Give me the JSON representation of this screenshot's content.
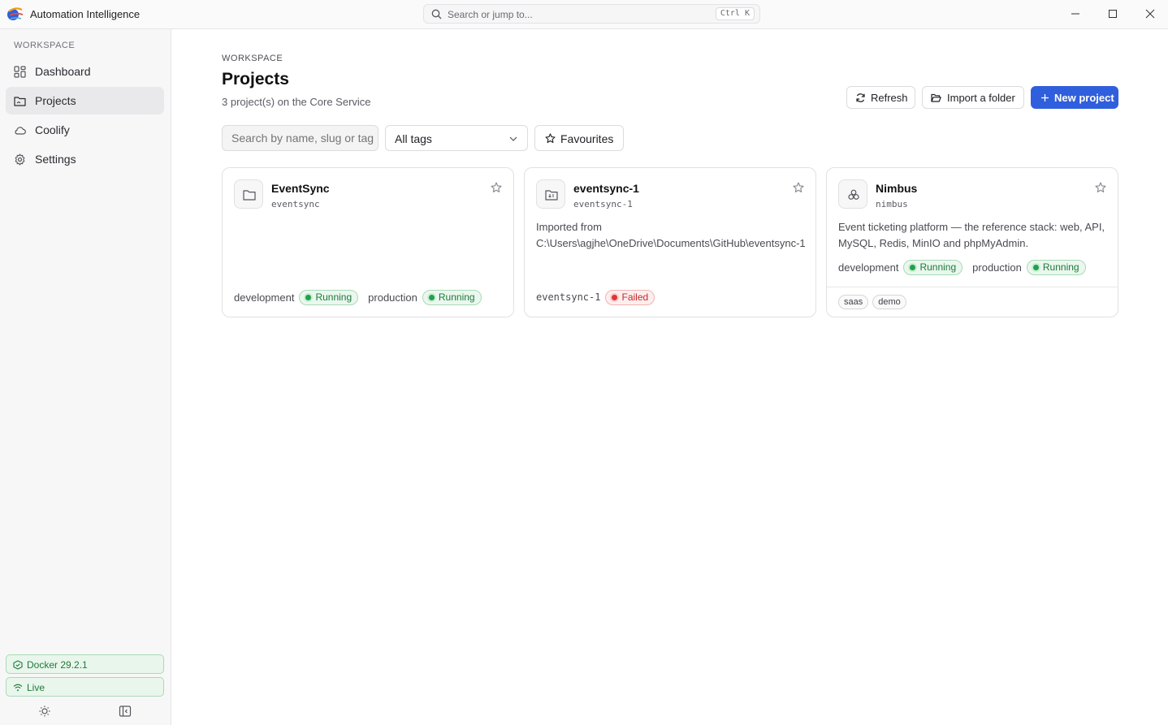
{
  "app": {
    "title": "Automation Intelligence"
  },
  "search": {
    "placeholder": "Search or jump to...",
    "shortcut": "Ctrl K"
  },
  "sidebar": {
    "section": "WORKSPACE",
    "items": [
      {
        "label": "Dashboard",
        "icon": "dashboard-icon"
      },
      {
        "label": "Projects",
        "icon": "folder-icon",
        "active": true
      },
      {
        "label": "Coolify",
        "icon": "cloud-icon"
      },
      {
        "label": "Settings",
        "icon": "gear-icon"
      }
    ],
    "docker_status": "Docker 29.2.1",
    "live_status": "Live"
  },
  "main": {
    "eyebrow": "WORKSPACE",
    "title": "Projects",
    "subtitle": "3 project(s) on the Core Service",
    "buttons": {
      "refresh": "Refresh",
      "import": "Import a folder",
      "new": "New project"
    },
    "filters": {
      "search_placeholder": "Search by name, slug or tag",
      "tags_select": "All tags",
      "favourites": "Favourites"
    }
  },
  "projects": [
    {
      "name": "EventSync",
      "slug": "eventsync",
      "description": "",
      "environments": [
        {
          "name": "development",
          "status": "Running"
        },
        {
          "name": "production",
          "status": "Running"
        }
      ],
      "tags": []
    },
    {
      "name": "eventsync-1",
      "slug": "eventsync-1",
      "description_line1": "Imported from",
      "description_line2": "C:\\Users\\agjhe\\OneDrive\\Documents\\GitHub\\eventsync-1",
      "environments": [
        {
          "name": "eventsync-1",
          "status": "Failed"
        }
      ],
      "tags": []
    },
    {
      "name": "Nimbus",
      "slug": "nimbus",
      "description": "Event ticketing platform — the reference stack: web, API, MySQL, Redis, MinIO and phpMyAdmin.",
      "environments": [
        {
          "name": "development",
          "status": "Running"
        },
        {
          "name": "production",
          "status": "Running"
        }
      ],
      "tags": [
        "saas",
        "demo"
      ]
    }
  ],
  "colors": {
    "accent": "#2f5fdc",
    "running": "#1f7a3a",
    "failed": "#c62828"
  }
}
